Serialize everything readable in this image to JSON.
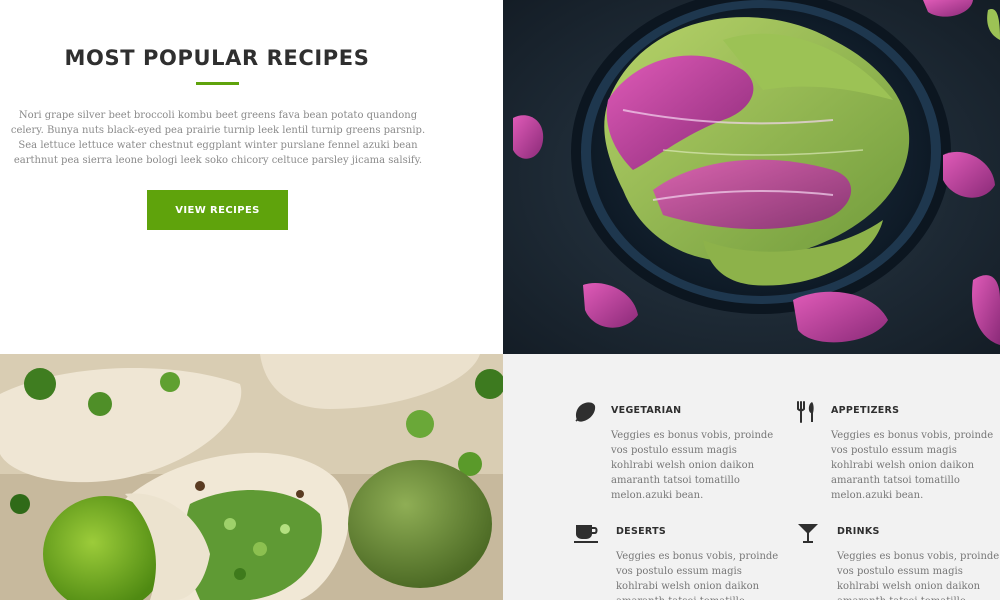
{
  "intro": {
    "title": "MOST POPULAR RECIPES",
    "text": "Nori grape silver beet broccoli kombu beet greens fava bean potato quandong celery. Bunya nuts black-eyed pea prairie turnip leek lentil turnip greens parsnip. Sea lettuce lettuce water chestnut eggplant winter purslane fennel azuki bean earthnut pea sierra leone bologi leek soko chicory celtuce parsley jicama salsify.",
    "button_label": "VIEW RECIPES"
  },
  "categories": [
    {
      "title": "VEGETARIAN",
      "icon": "lemon-icon",
      "text": "Veggies es bonus vobis, proinde vos postulo essum magis kohlrabi welsh onion daikon amaranth tatsoi tomatillo melon.azuki bean."
    },
    {
      "title": "APPETIZERS",
      "icon": "fork-knife-icon",
      "text": "Veggies es bonus vobis, proinde vos postulo essum magis kohlrabi welsh onion daikon amaranth tatsoi tomatillo melon.azuki bean."
    },
    {
      "title": "DESERTS",
      "icon": "coffee-cup-icon",
      "text": "Veggies es bonus vobis, proinde vos postulo essum magis kohlrabi welsh onion daikon amaranth tatsoi tomatillo melon.azuki bean."
    },
    {
      "title": "DRINKS",
      "icon": "cocktail-glass-icon",
      "text": "Veggies es bonus vobis, proinde vos postulo essum magis kohlrabi welsh onion daikon amaranth tatsoi tomatillo melon.azuki bean."
    }
  ],
  "colors": {
    "accent": "#5fa30c",
    "heading": "#2f2f2f",
    "body_text": "#8a8a8a",
    "panel_bg": "#f2f2f2"
  }
}
